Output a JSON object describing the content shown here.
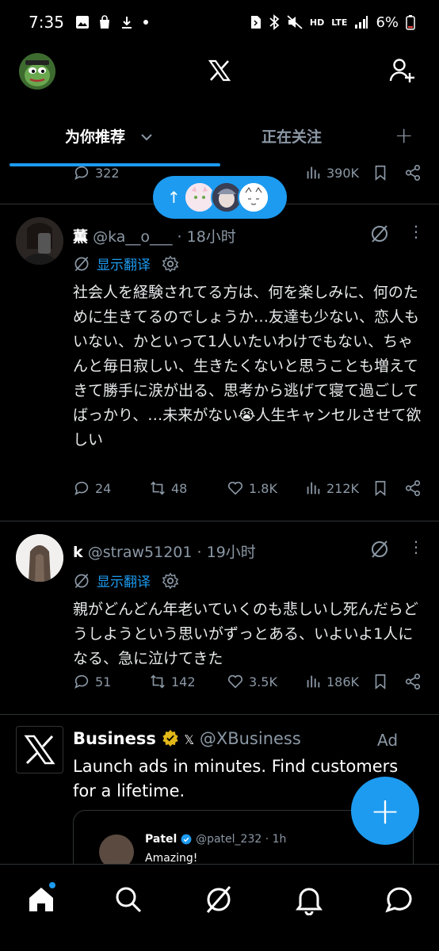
{
  "status_bar": {
    "time": "7:35",
    "left_icons": [
      "image-icon",
      "bag-icon",
      "download-icon",
      "dot-icon"
    ],
    "right_icons": [
      "sim-icon",
      "bluetooth-icon",
      "mute-icon"
    ],
    "hd_label": "HD",
    "lte_label": "LTE",
    "battery": "6%"
  },
  "header": {
    "logo": "X"
  },
  "tabs": [
    {
      "label": "为你推荐"
    },
    {
      "label": "正在关注"
    }
  ],
  "partial_tweet": {
    "replies": "322",
    "views": "390K"
  },
  "tweets": [
    {
      "name": "薫",
      "handle": "@ka__o___",
      "time": "· 18小时",
      "translate": "显示翻译",
      "text": "社会人を経験されてる方は、何を楽しみに、何のために生きてるのでしょうか…友達も少ない、恋人もいない、かといって1人いたいわけでもない、ちゃんと毎日寂しい、生きたくないと思うことも増えてきて勝手に涙が出る、思考から逃げて寝て過ごしてばっかり、…未来がない😭人生キャンセルさせて欲しい",
      "replies": "24",
      "retweets": "48",
      "likes": "1.8K",
      "views": "212K"
    },
    {
      "name": "k",
      "handle": "@straw51201",
      "time": "· 19小时",
      "translate": "显示翻译",
      "text": "親がどんどん年老いていくのも悲しいし死んだらどうしようという思いがずっとある、いよいよ1人になる、急に泣けてきた",
      "replies": "51",
      "retweets": "142",
      "likes": "3.5K",
      "views": "186K"
    }
  ],
  "ad": {
    "name": "Business",
    "affiliate": "𝕏",
    "handle": "@XBusiness",
    "tag": "Ad",
    "text": "Launch ads in minutes. Find customers for a lifetime.",
    "card_name": "Patel",
    "card_handle": "@patel_232 · 1h",
    "card_text": "Amazing!"
  },
  "fab": "+",
  "colors": {
    "accent": "#1d9bf0",
    "background": "#000000",
    "secondary_text": "#8b98a5",
    "verified_gold": "#e2b719"
  }
}
